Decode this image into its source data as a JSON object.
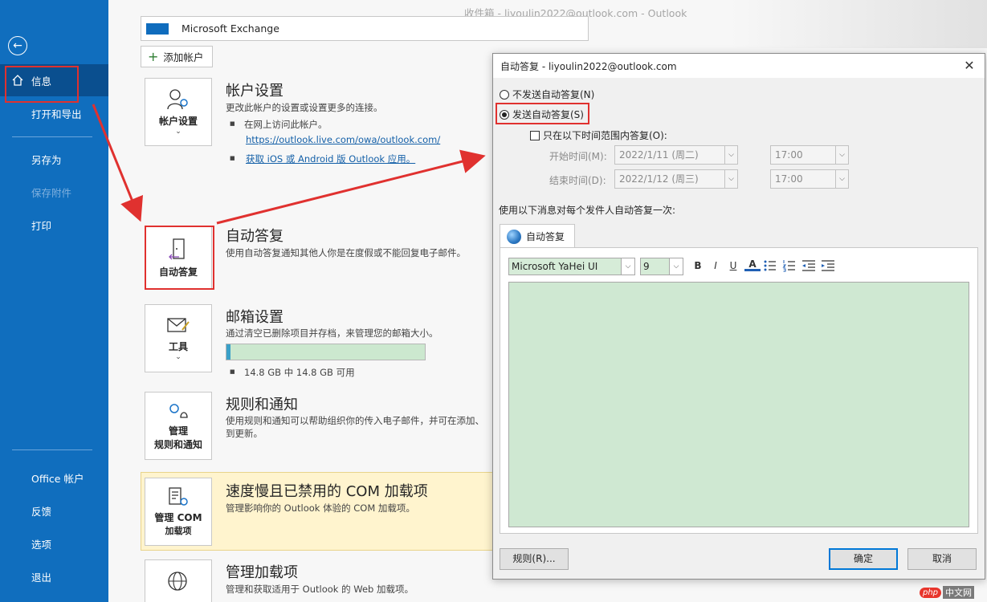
{
  "window": {
    "title": "收件箱 - liyoulin2022@outlook.com  -  Outlook"
  },
  "sidebar": {
    "items": [
      {
        "label": "信息",
        "active": true
      },
      {
        "label": "打开和导出"
      },
      {
        "label": "另存为"
      },
      {
        "label": "保存附件",
        "disabled": true
      },
      {
        "label": "打印"
      },
      {
        "label": "Office 帐户"
      },
      {
        "label": "反馈"
      },
      {
        "label": "选项"
      },
      {
        "label": "退出"
      }
    ]
  },
  "account": {
    "name": "Microsoft Exchange",
    "add_label": "添加帐户"
  },
  "sections": {
    "account_settings": {
      "tile": "帐户设置",
      "title": "帐户设置",
      "desc": "更改此帐户的设置或设置更多的连接。",
      "bullet": "在网上访问此帐户。",
      "link1": "https://outlook.live.com/owa/outlook.com/",
      "link2": "获取 iOS 或 Android 版 Outlook 应用。"
    },
    "auto_reply": {
      "tile": "自动答复",
      "title": "自动答复",
      "desc": "使用自动答复通知其他人你是在度假或不能回复电子邮件。"
    },
    "mailbox": {
      "tile": "工具",
      "title": "邮箱设置",
      "desc": "通过清空已删除项目并存档，来管理您的邮箱大小。",
      "storage": "14.8 GB 中 14.8 GB 可用",
      "usage_fraction": 0.02
    },
    "rules": {
      "tile_line1": "管理",
      "tile_line2": "规则和通知",
      "title": "规则和通知",
      "desc1": "使用规则和通知可以帮助组织你的传入电子邮件，并可在添加、",
      "desc2": "到更新。"
    },
    "com": {
      "tile_line1": "管理 COM",
      "tile_line2": "加载项",
      "title": "速度慢且已禁用的 COM 加载项",
      "desc": "管理影响你的 Outlook 体验的 COM 加载项。"
    },
    "addins": {
      "title": "管理加载项",
      "desc": "管理和获取适用于 Outlook 的 Web 加载项。"
    }
  },
  "dialog": {
    "title": "自动答复 - liyoulin2022@outlook.com",
    "close": "✕",
    "radio_off": "不发送自动答复(N)",
    "radio_on": "发送自动答复(S)",
    "range_check": "只在以下时间范围内答复(O):",
    "start_label": "开始时间(M):",
    "start_date": "2022/1/11 (周二)",
    "start_time": "17:00",
    "end_label": "结束时间(D):",
    "end_date": "2022/1/12 (周三)",
    "end_time": "17:00",
    "instruction": "使用以下消息对每个发件人自动答复一次:",
    "tab": "自动答复",
    "font": "Microsoft YaHei UI",
    "font_size": "9",
    "bold": "B",
    "italic": "I",
    "underline": "U",
    "font_color": "A",
    "rules_btn": "规则(R)...",
    "ok_btn": "确定",
    "cancel_btn": "取消"
  },
  "watermark": {
    "php": "php",
    "cn": "中文网"
  },
  "colors": {
    "sidebar": "#106ebe",
    "highlight": "#e0312f",
    "accent": "#0078d7"
  }
}
